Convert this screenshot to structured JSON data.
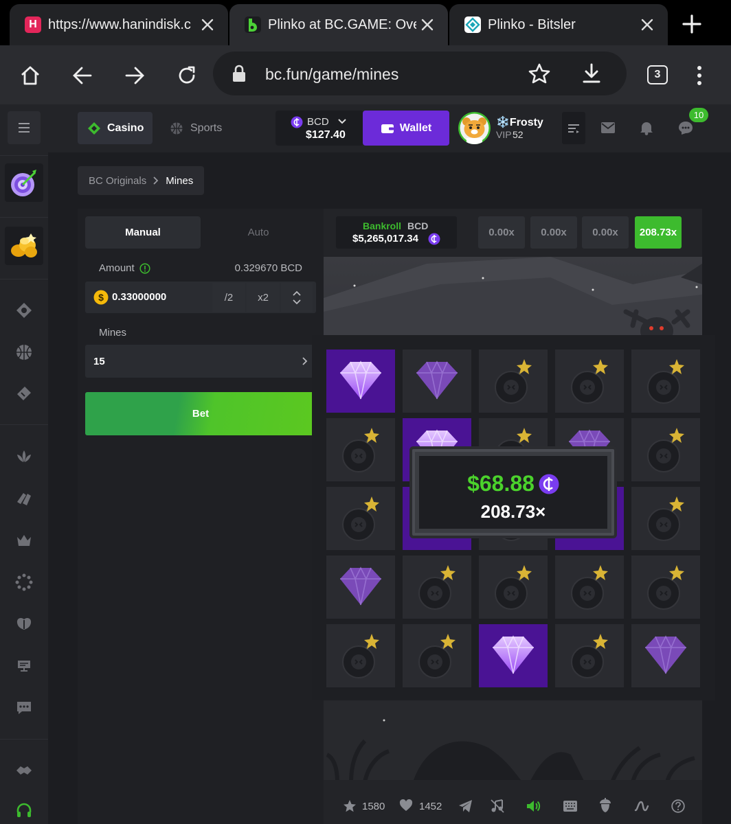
{
  "browser": {
    "tabs": [
      {
        "title": "https://www.hanindisk.c",
        "favicon_letter": "H",
        "favicon_color": "#e3265a"
      },
      {
        "title": "Plinko at BC.GAME: Ove",
        "favicon_letter": "b",
        "favicon_color": "#1b1c1f"
      },
      {
        "title": "Plinko - Bitsler",
        "favicon_letter": "",
        "favicon_color": "#ffffff"
      }
    ],
    "url": "bc.fun/game/mines",
    "tab_count": "3"
  },
  "header": {
    "casino": "Casino",
    "sports": "Sports",
    "currency": "BCD",
    "balance": "$127.40",
    "wallet": "Wallet",
    "username": "❄️Frosty",
    "vip": "VIP",
    "vip_level": "52",
    "chat_badge": "10"
  },
  "breadcrumb": {
    "parent": "BC Originals",
    "current": "Mines"
  },
  "controls": {
    "tab_manual": "Manual",
    "tab_auto": "Auto",
    "amount_label": "Amount",
    "amount_converted": "0.329670 BCD",
    "amount_value": "0.33000000",
    "half": "/2",
    "double": "x2",
    "mines_label": "Mines",
    "mines_value": "15",
    "bet": "Bet"
  },
  "bankroll": {
    "label": "Bankroll",
    "currency": "BCD",
    "value": "$5,265,017.34"
  },
  "multipliers": [
    "0.00x",
    "0.00x",
    "0.00x",
    "208.73x"
  ],
  "win": {
    "amount": "$68.88",
    "multiplier": "208.73×"
  },
  "board": [
    [
      "gem-active",
      "gem",
      "bomb",
      "bomb",
      "bomb"
    ],
    [
      "bomb",
      "gem-active",
      "bomb",
      "gem",
      "bomb"
    ],
    [
      "bomb",
      "gem-active",
      "bomb",
      "gem-active",
      "bomb"
    ],
    [
      "gem",
      "bomb",
      "bomb",
      "bomb",
      "bomb"
    ],
    [
      "bomb",
      "bomb",
      "gem-active",
      "bomb",
      "gem"
    ]
  ],
  "footer": {
    "favorites": "1580",
    "likes": "1452"
  },
  "colors": {
    "green": "#3dbb2e",
    "purple": "#6c2bd9",
    "tile_revealed": "#4a1394",
    "win_green": "#4bd22c"
  }
}
